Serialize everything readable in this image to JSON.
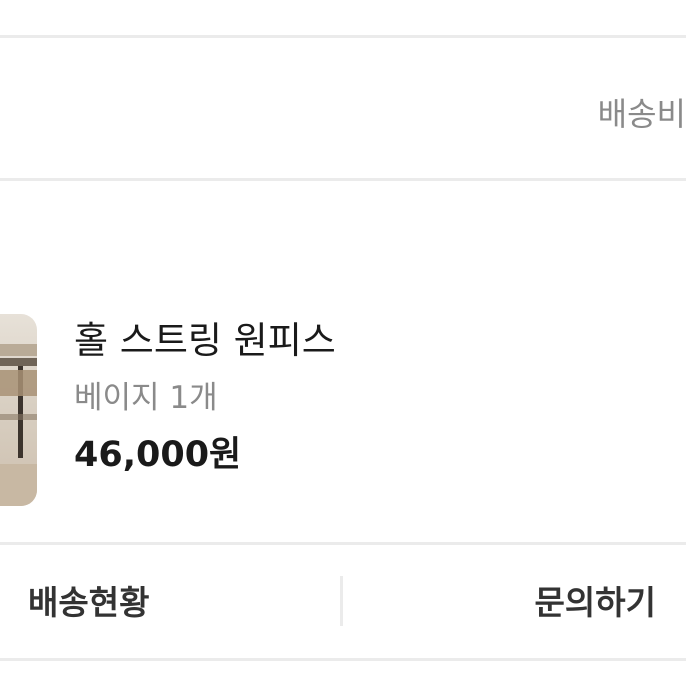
{
  "shipping": {
    "fee_label": "배송비"
  },
  "product": {
    "name": "홀 스트링 원피스",
    "option": "베이지 1개",
    "price": "46,000원",
    "thumbnail_icon": "product-photo"
  },
  "actions": {
    "shipping_status_label": "배송현황",
    "inquiry_label": "문의하기"
  },
  "colors": {
    "divider": "#ebebeb",
    "secondary_text": "#8a8a8a",
    "primary_text": "#1a1a1a"
  }
}
